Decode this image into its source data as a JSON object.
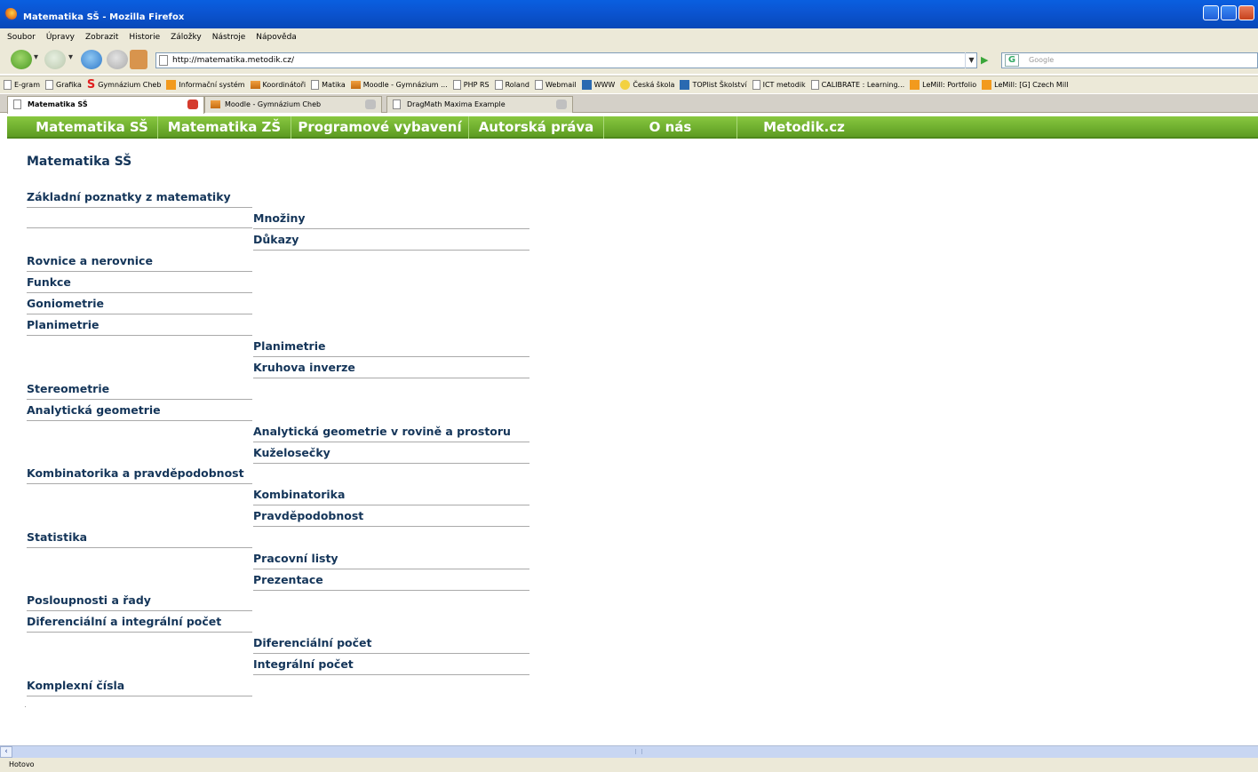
{
  "window": {
    "title": "Matematika SŠ - Mozilla Firefox"
  },
  "menu": [
    "Soubor",
    "Úpravy",
    "Zobrazit",
    "Historie",
    "Záložky",
    "Nástroje",
    "Nápověda"
  ],
  "address": {
    "url": "http://matematika.metodik.cz/"
  },
  "search": {
    "placeholder": "Google"
  },
  "bookmarks": [
    "E-gram",
    "Grafika",
    "Gymnázium Cheb",
    "Informační systém",
    "Koordinátoři",
    "Matika",
    "Moodle - Gymnázium ...",
    "PHP RS",
    "Roland",
    "Webmail",
    "WWW",
    "Česká škola",
    "TOPlist Školství",
    "ICT metodik",
    "CALIBRATE : Learning...",
    "LeMill: Portfolio",
    "LeMill: [G] Czech Mill"
  ],
  "tabs": [
    "Matematika SŠ",
    "Moodle - Gymnázium Cheb",
    "DragMath Maxima Example"
  ],
  "sitenav": [
    "Matematika SŠ",
    "Matematika ZŠ",
    "Programové vybavení",
    "Autorská práva",
    "O nás",
    "Metodik.cz"
  ],
  "page": {
    "title": "Matematika SŠ",
    "sections": [
      {
        "label": "Základní poznatky z matematiky",
        "children": [
          "Množiny",
          "Důkazy"
        ]
      },
      {
        "label": "Rovnice a nerovnice",
        "children": []
      },
      {
        "label": "Funkce",
        "children": []
      },
      {
        "label": "Goniometrie",
        "children": []
      },
      {
        "label": "Planimetrie",
        "children": [
          "Planimetrie",
          "Kruhova inverze"
        ]
      },
      {
        "label": "Stereometrie",
        "children": []
      },
      {
        "label": "Analytická geometrie",
        "children": [
          "Analytická geometrie v rovině a prostoru",
          "Kuželosečky"
        ]
      },
      {
        "label": "Kombinatorika a pravděpodobnost",
        "children": [
          "Kombinatorika",
          "Pravděpodobnost"
        ]
      },
      {
        "label": "Statistika",
        "children": [
          "Pracovní listy",
          "Prezentace"
        ]
      },
      {
        "label": "Posloupnosti a řady",
        "children": []
      },
      {
        "label": "Diferenciální a integrální počet",
        "children": [
          "Diferenciální počet",
          "Integrální počet"
        ]
      },
      {
        "label": "Komplexní čísla",
        "children": []
      }
    ]
  },
  "status": "Hotovo"
}
